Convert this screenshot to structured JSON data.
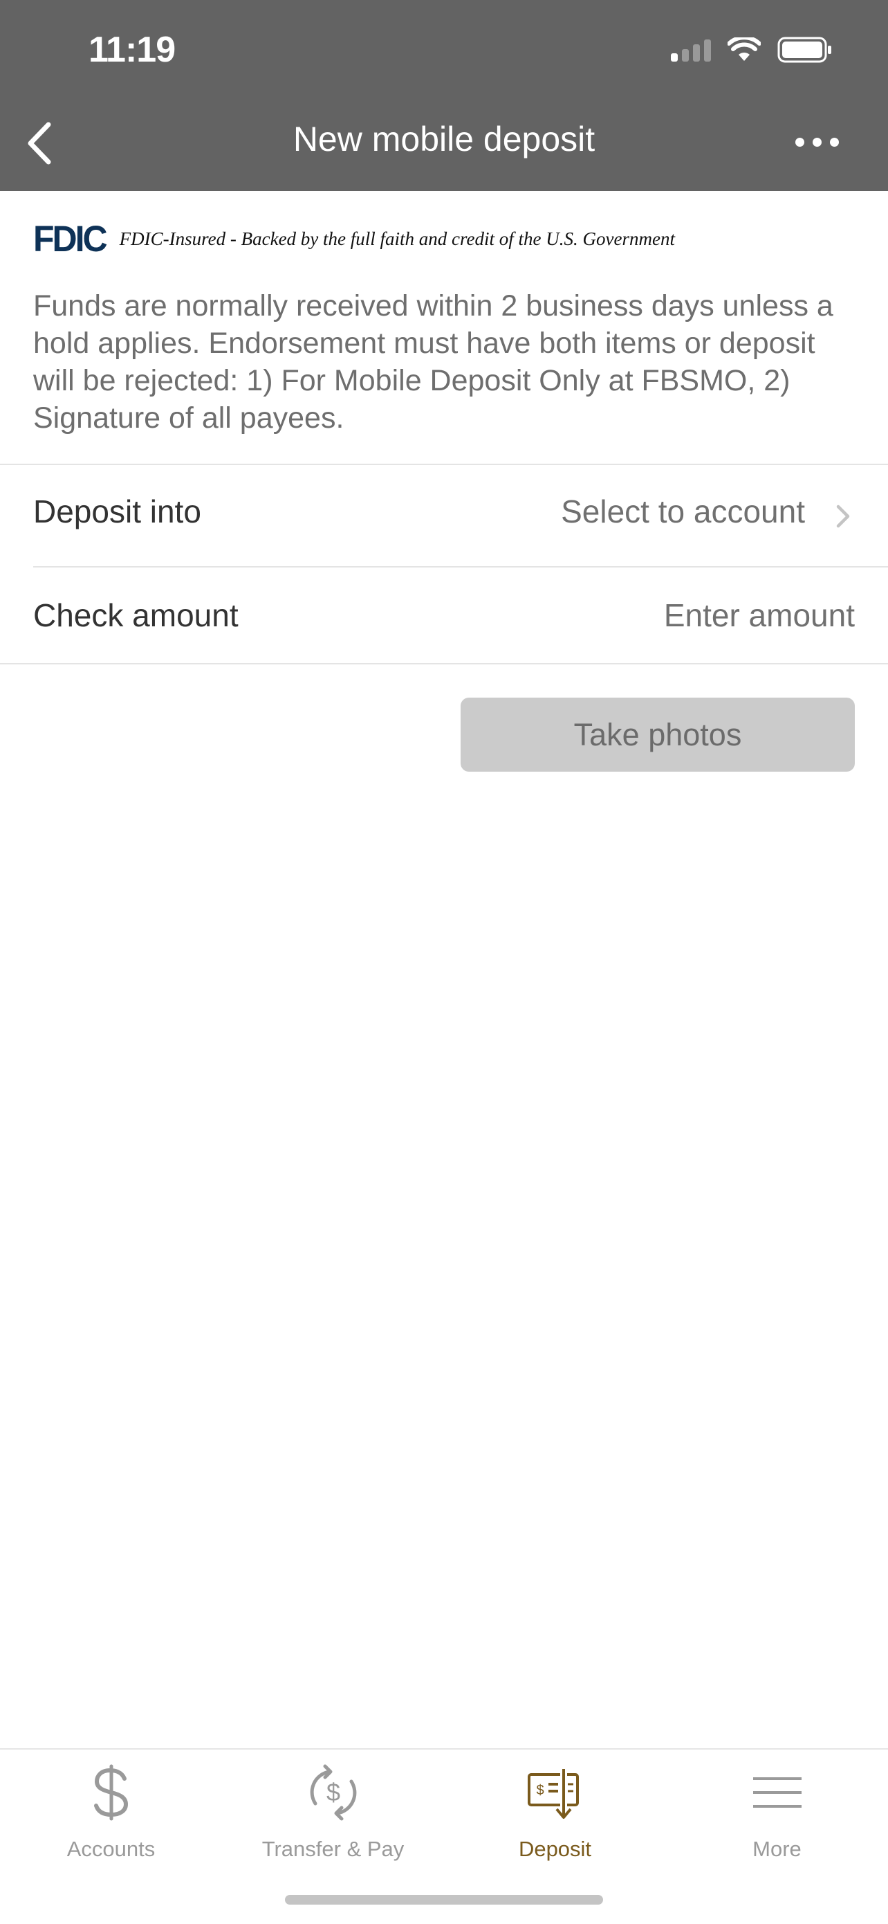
{
  "status_bar": {
    "time": "11:19"
  },
  "nav": {
    "title": "New mobile deposit"
  },
  "fdic": {
    "logo": "FDIC",
    "text": "FDIC-Insured - Backed by the full faith and credit of the U.S. Government"
  },
  "notice": "Funds are normally received within 2 business days unless a hold applies. Endorsement must have both items or deposit will be rejected: 1) For Mobile Deposit Only at FBSMO, 2) Signature of all payees.",
  "form": {
    "deposit_into": {
      "label": "Deposit into",
      "value": "Select to account"
    },
    "check_amount": {
      "label": "Check amount",
      "placeholder": "Enter amount"
    }
  },
  "take_photos_label": "Take photos",
  "tabs": [
    {
      "label": "Accounts",
      "icon": "dollar-icon"
    },
    {
      "label": "Transfer & Pay",
      "icon": "transfer-icon"
    },
    {
      "label": "Deposit",
      "icon": "deposit-check-icon"
    },
    {
      "label": "More",
      "icon": "menu-icon"
    }
  ],
  "colors": {
    "header": "#636363",
    "accent": "#7a5a1c",
    "fdic": "#0e3257"
  }
}
